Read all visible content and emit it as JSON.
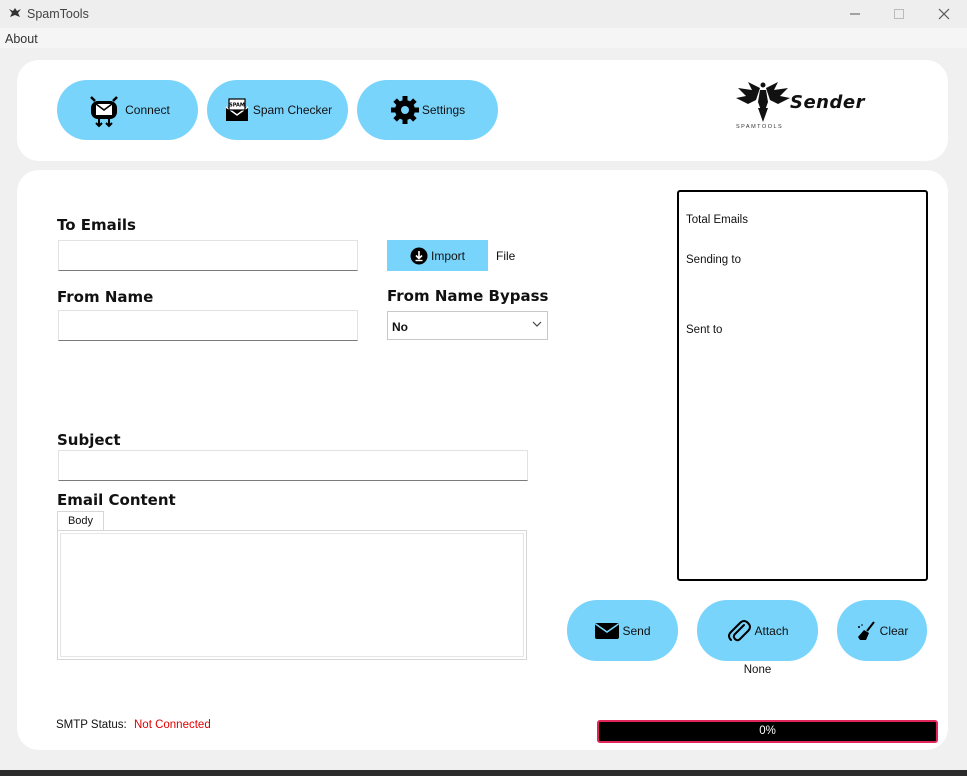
{
  "window": {
    "title": "SpamTools"
  },
  "menu": {
    "about": "About"
  },
  "toolbar": {
    "connect": "Connect",
    "spam_checker": "Spam Checker",
    "settings": "Settings"
  },
  "logo": {
    "name": "Sender",
    "sub": "SPAMTOOLS"
  },
  "form": {
    "to_label": "To Emails",
    "to_value": "",
    "import_label": "Import",
    "file_label": "File",
    "from_label": "From Name",
    "from_value": "",
    "bypass_label": "From Name Bypass",
    "bypass_selected": "No",
    "subject_label": "Subject",
    "subject_value": "",
    "content_label": "Email Content",
    "body_tab": "Body"
  },
  "stats": {
    "total": "Total Emails",
    "sending": "Sending to",
    "sent": "Sent to"
  },
  "actions": {
    "send": "Send",
    "attach": "Attach",
    "clear": "Clear",
    "attachment": "None"
  },
  "status": {
    "smtp_label": "SMTP Status:",
    "smtp_value": "Not Connected",
    "progress_text": "0%",
    "progress_value": 0
  },
  "colors": {
    "accent": "#79d4fb",
    "error": "#e00000",
    "progress_border": "#e0255a"
  }
}
